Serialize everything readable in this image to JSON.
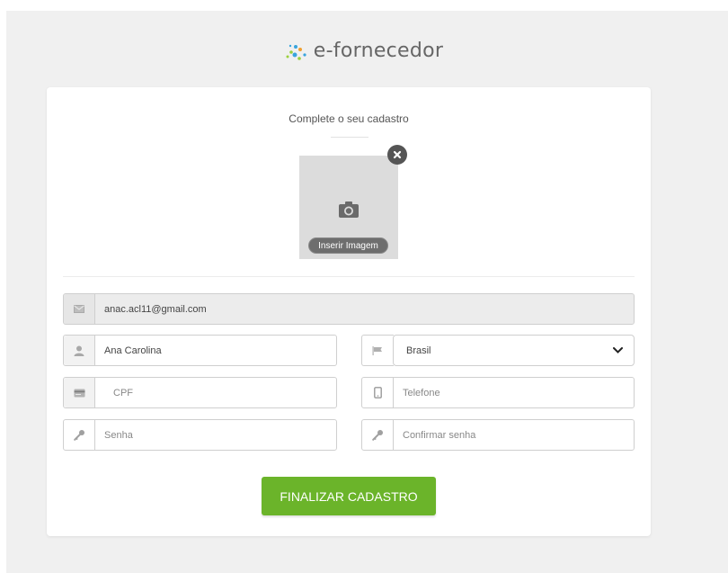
{
  "brand": {
    "name": "e-fornecedor",
    "dot_colors": [
      "#9ad03c",
      "#39a4dd",
      "#f0a030"
    ]
  },
  "form": {
    "title": "Complete o seu cadastro",
    "image": {
      "insert_label": "Inserir Imagem",
      "icon": "camera-icon",
      "close_icon": "close-icon"
    },
    "fields": {
      "email": {
        "value": "anac.acl11@gmail.com",
        "icon": "envelope-icon",
        "disabled": true
      },
      "name": {
        "value": "Ana Carolina",
        "icon": "user-icon"
      },
      "country": {
        "value": "Brasil",
        "icon": "flag-icon"
      },
      "cpf": {
        "placeholder": "CPF",
        "icon": "id-card-icon"
      },
      "phone": {
        "placeholder": "Telefone",
        "icon": "phone-icon"
      },
      "password": {
        "placeholder": "Senha",
        "icon": "key-icon"
      },
      "confirm_password": {
        "placeholder": "Confirmar senha",
        "icon": "key-icon"
      }
    },
    "submit_label": "FINALIZAR CADASTRO"
  },
  "colors": {
    "accent": "#6bb42a",
    "background": "#f0f0f0",
    "card": "#ffffff"
  }
}
